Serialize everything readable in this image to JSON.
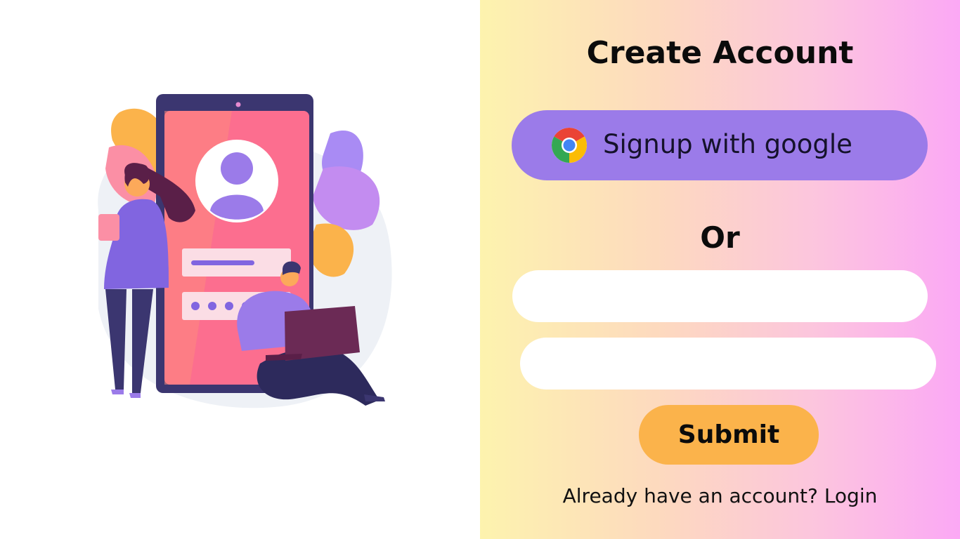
{
  "form": {
    "title": "Create Account",
    "google_button_label": "Signup with google",
    "google_icon": "chrome-icon",
    "separator": "Or",
    "field1": {
      "value": "",
      "placeholder": ""
    },
    "field2": {
      "value": "",
      "placeholder": ""
    },
    "submit_label": "Submit",
    "footer_text": "Already have an account?",
    "login_link": "Login"
  },
  "colors": {
    "google_button": "#9b7be9",
    "submit_button": "#fbb34b",
    "gradient_start": "#fdf3ae",
    "gradient_end": "#fba8f5"
  },
  "illustration": "signup-illustration"
}
